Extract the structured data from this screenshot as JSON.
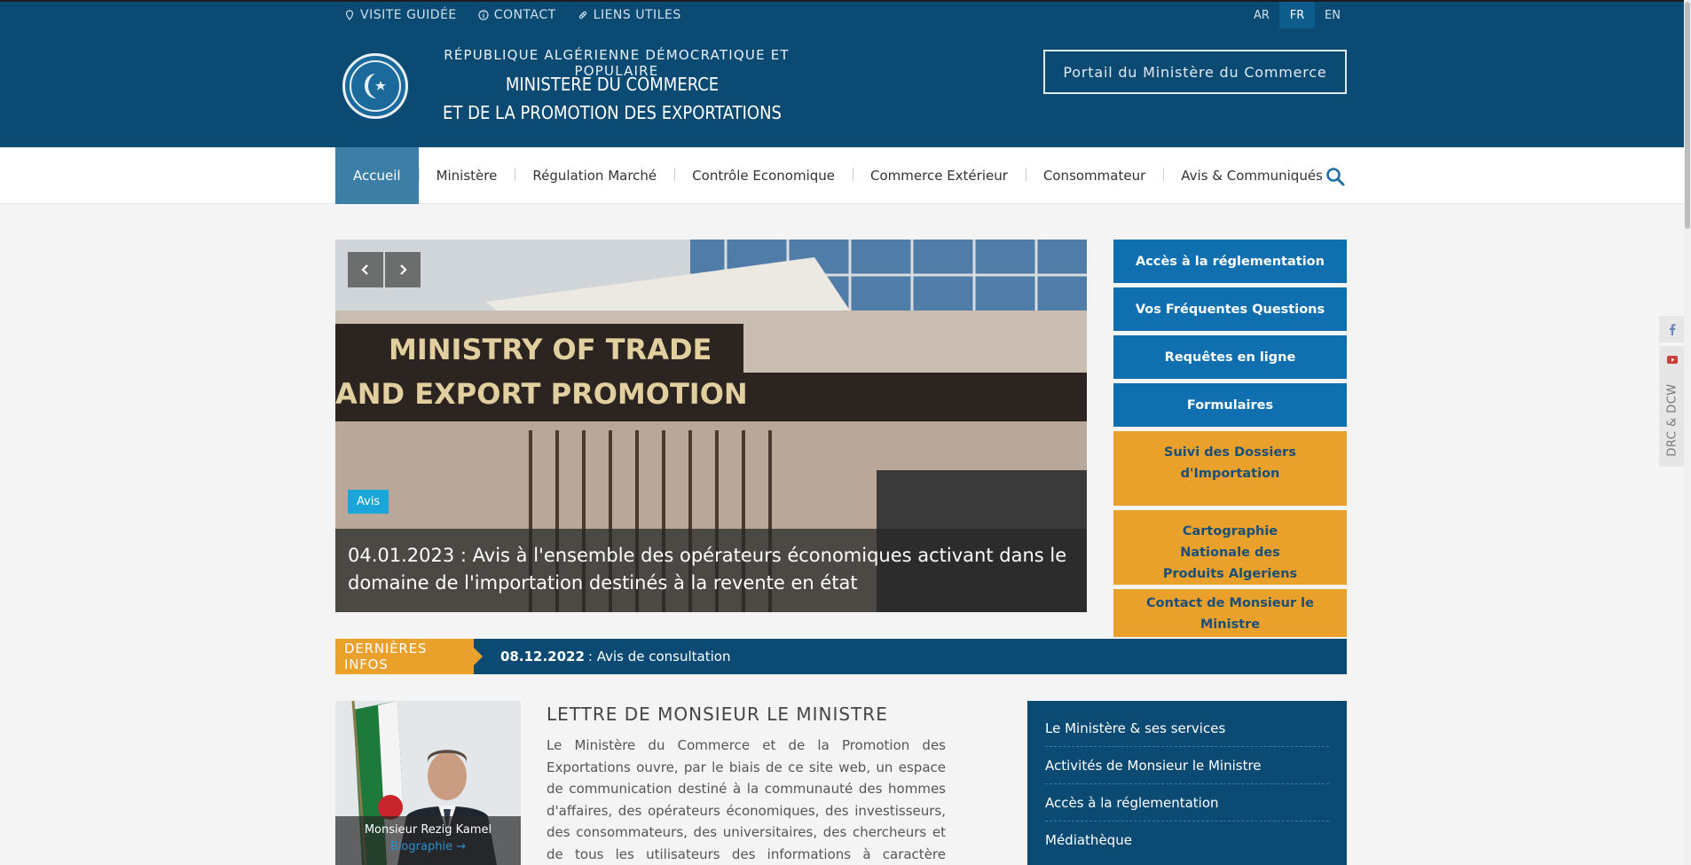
{
  "topbar": {
    "links": [
      "VISITE GUIDÉE",
      "CONTACT",
      "LIENS UTILES"
    ],
    "languages": [
      "AR",
      "FR",
      "EN"
    ],
    "active_language": "FR"
  },
  "header": {
    "republic": "RÉPUBLIQUE ALGÉRIENNE DÉMOCRATIQUE ET POPULAIRE",
    "ministry_line1": "MINISTERE DU COMMERCE",
    "ministry_line2": "ET DE LA PROMOTION DES EXPORTATIONS",
    "portal_button": "Portail du Ministère du Commerce"
  },
  "nav": {
    "items": [
      "Accueil",
      "Ministère",
      "Régulation Marché",
      "Contrôle Economique",
      "Commerce Extérieur",
      "Consommateur",
      "Avis & Communiqués"
    ],
    "active": "Accueil"
  },
  "slider": {
    "tag": "Avis",
    "caption": "04.01.2023 : Avis à l'ensemble des opérateurs économiques activant dans le domaine de l'importation destinés à la revente en état",
    "sign_line1": "MINISTRY OF TRADE",
    "sign_line2": "AND EXPORT PROMOTION"
  },
  "side_buttons": {
    "blue": [
      "Accès à la réglementation",
      "Vos Fréquentes Questions",
      "Requêtes en ligne",
      "Formulaires"
    ],
    "orange": [
      "Suivi des Dossiers d'Importation",
      "Cartographie Nationale des Produits Algeriens",
      "Contact de Monsieur le Ministre kamel.rezig@commerce.gov.dz"
    ]
  },
  "ticker": {
    "label": "DERNIÈRES INFOS",
    "date": "08.12.2022",
    "text": ": Avis de consultation"
  },
  "minister": {
    "name": "Monsieur Rezig Kamel",
    "bio_link": "Biographie →"
  },
  "letter": {
    "title": "LETTRE DE MONSIEUR LE MINISTRE",
    "text": "Le Ministère du Commerce et de la Promotion des Exportations ouvre, par le biais de ce site web, un espace de communication destiné à la communauté des hommes d'affaires, des opérateurs économiques, des investisseurs, des consommateurs, des universitaires, des chercheurs et de tous les utilisateurs des informations à caractère commercial"
  },
  "right_list": {
    "items": [
      "Le Ministère & ses services",
      "Activités de Monsieur le Ministre",
      "Accès à la réglementation",
      "Médiathèque"
    ]
  },
  "floating": {
    "drc_label": "DRC & DCW"
  },
  "colors": {
    "header_blue": "#0b4a72",
    "button_blue": "#0f6faf",
    "accent_orange": "#eaa12c",
    "nav_active": "#3d7ea6"
  }
}
